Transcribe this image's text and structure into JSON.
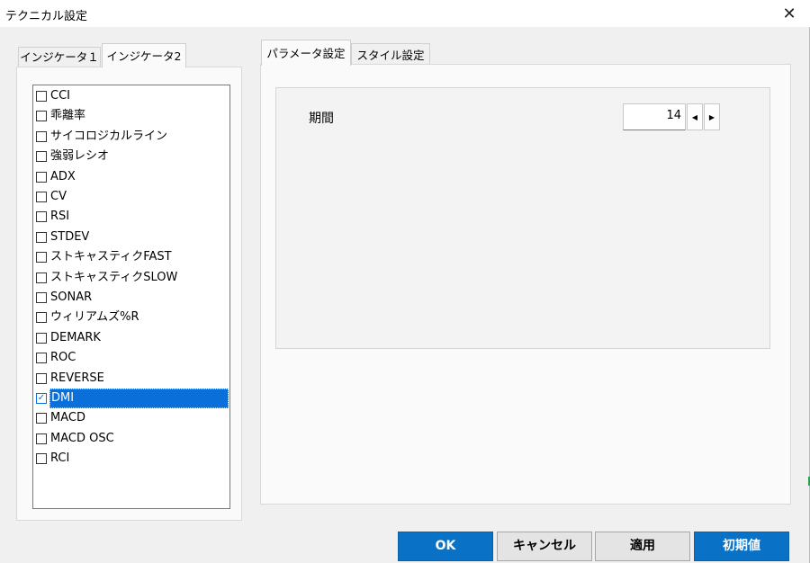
{
  "window": {
    "title": "テクニカル設定"
  },
  "colors": {
    "accent": "#0a72c6",
    "selection": "#0a6fd8"
  },
  "icons": {
    "close": "close-icon",
    "check": "checkmark-icon",
    "spin_left": "triangle-left-icon",
    "spin_right": "triangle-right-icon"
  },
  "left_tabs": [
    {
      "label": "インジケータ１",
      "active": false
    },
    {
      "label": "インジケータ2",
      "active": true
    }
  ],
  "indicators": [
    {
      "label": "CCI",
      "checked": false
    },
    {
      "label": "乖離率",
      "checked": false
    },
    {
      "label": "サイコロジカルライン",
      "checked": false
    },
    {
      "label": "強弱レシオ",
      "checked": false
    },
    {
      "label": "ADX",
      "checked": false
    },
    {
      "label": "CV",
      "checked": false
    },
    {
      "label": "RSI",
      "checked": false
    },
    {
      "label": "STDEV",
      "checked": false
    },
    {
      "label": "ストキャスティクFAST",
      "checked": false
    },
    {
      "label": "ストキャスティクSLOW",
      "checked": false
    },
    {
      "label": "SONAR",
      "checked": false
    },
    {
      "label": "ウィリアムズ%R",
      "checked": false
    },
    {
      "label": "DEMARK",
      "checked": false
    },
    {
      "label": "ROC",
      "checked": false
    },
    {
      "label": "REVERSE",
      "checked": false
    },
    {
      "label": "DMI",
      "checked": true,
      "selected": true
    },
    {
      "label": "MACD",
      "checked": false
    },
    {
      "label": "MACD OSC",
      "checked": false
    },
    {
      "label": "RCI",
      "checked": false
    }
  ],
  "right_tabs": [
    {
      "label": "パラメータ設定",
      "active": true
    },
    {
      "label": "スタイル設定",
      "active": false
    }
  ],
  "params": {
    "period_label": "期間",
    "period_value": "14"
  },
  "buttons": {
    "ok": "OK",
    "cancel": "キャンセル",
    "apply": "適用",
    "default": "初期値"
  }
}
